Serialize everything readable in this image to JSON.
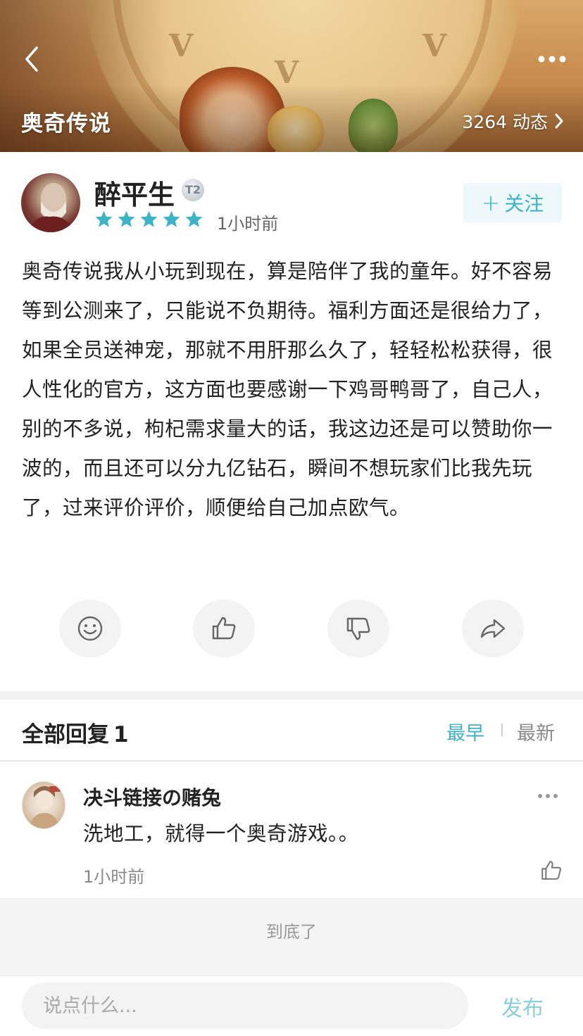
{
  "header": {
    "game_title": "奥奇传说",
    "activity_text": "3264 动态"
  },
  "author": {
    "name": "醉平生",
    "level": "T2",
    "rating": 5,
    "time": "1小时前",
    "follow_plus": "+",
    "follow_label": "关注"
  },
  "review": {
    "text": "奥奇传说我从小玩到现在，算是陪伴了我的童年。好不容易等到公测来了，只能说不负期待。福利方面还是很给力了，如果全员送神宠，那就不用肝那么久了，轻轻松松获得，很人性化的官方，这方面也要感谢一下鸡哥鸭哥了，自己人，别的不多说，枸杞需求量大的话，我这边还是可以赞助你一波的，而且还可以分九亿钻石，瞬间不想玩家们比我先玩了，过来评价评价，顺便给自己加点欧气。"
  },
  "actions": [
    "smile-icon",
    "thumbs-up-icon",
    "thumbs-down-icon",
    "share-icon"
  ],
  "replies": {
    "title": "全部回复",
    "count": "1",
    "sort_earliest": "最早",
    "sort_latest": "最新",
    "items": [
      {
        "name": "决斗链接の赌兔",
        "text": "洗地工，就得一个奥奇游戏。。",
        "time": "1小时前"
      }
    ],
    "end_text": "到底了"
  },
  "input": {
    "placeholder": "说点什么...",
    "publish_label": "发布"
  },
  "colors": {
    "accent": "#3eb2c6",
    "publish": "#8ccfdc",
    "star": "#3eb2c6"
  }
}
